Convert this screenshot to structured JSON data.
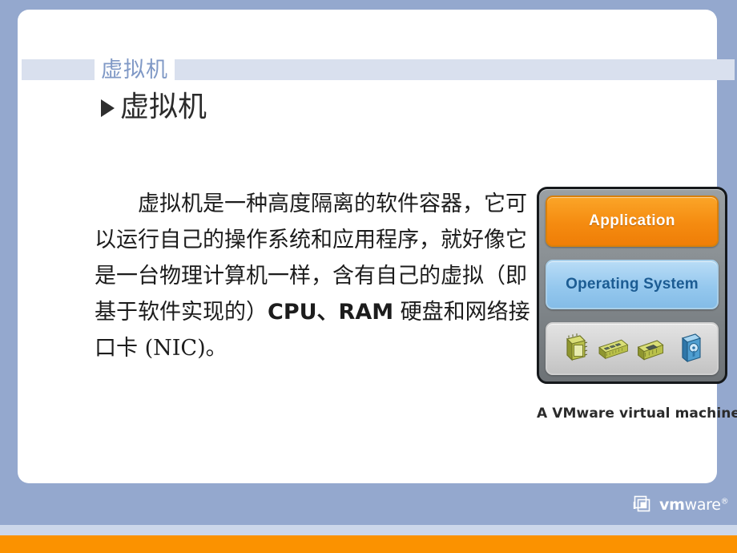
{
  "slide": {
    "title": "虚拟机",
    "heading": "虚拟机",
    "bullet_icon": "triangle-right-icon",
    "body": {
      "text_serif_lead": "虚拟机是一种高度隔离的软件容器，它可以运行自己的操作系统和应用程序，就好像它是一台物理计算机一样，含有自己的虚拟（即基于软件实现的）",
      "text_bold_run": "CPU、RAM",
      "text_serif_tail": " 硬盘和网络接口卡 (NIC)。",
      "full_text": "虚拟机是一种高度隔离的软件容器，它可以运行自己的操作系统和应用程序，就好像它是一台物理计算机一样，含有自己的虚拟（即基于软件实现的）CPU、RAM 硬盘和网络接口卡 (NIC)。"
    }
  },
  "figure": {
    "caption": "A VMware virtual machine",
    "layers": [
      {
        "id": "application",
        "label": "Application",
        "fill": "#F58B10",
        "text_color": "#FFFFFF"
      },
      {
        "id": "operating_system",
        "label": "Operating System",
        "fill": "#95C8EE",
        "text_color": "#1C5C93"
      },
      {
        "id": "hardware",
        "label": "",
        "fill": "#D2D2D2",
        "text_color": "#333333"
      }
    ],
    "hardware_icons": [
      {
        "name": "cpu-chip-icon",
        "label": "CPU"
      },
      {
        "name": "ram-module-icon",
        "label": "RAM"
      },
      {
        "name": "network-interface-card-icon",
        "label": "NIC"
      },
      {
        "name": "hard-disk-icon",
        "label": "Disk"
      }
    ],
    "frame_color": "#82888C",
    "frame_border_color": "#15181B"
  },
  "footer": {
    "brand_mark": "vm",
    "brand_rest": "ware",
    "brand_registered": "®",
    "logo_icon": "vmware-stacked-squares-icon"
  },
  "theme": {
    "background": "#94A8CE",
    "card": "#FFFFFF",
    "header_strip": "#D9E0EE",
    "title_text": "#8099C6",
    "footer_light_band": "#CCD7EA",
    "footer_orange_band": "#FB9200",
    "body_text": "#1C1C1C"
  }
}
